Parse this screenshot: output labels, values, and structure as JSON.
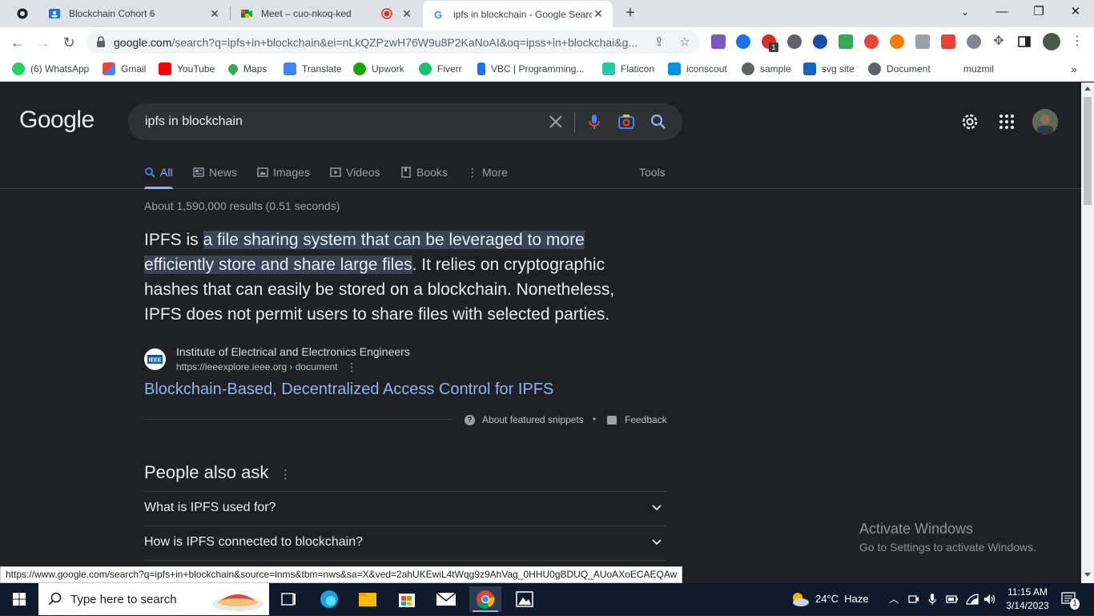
{
  "browser": {
    "tabs": [
      {
        "title": "Blockchain Cohort 6",
        "active": false
      },
      {
        "title": "Meet – cuo-nkoq-ked",
        "active": false
      },
      {
        "title": "ipfs in blockchain - Google Searc",
        "active": true
      }
    ],
    "url_host": "google.com",
    "url_rest": "/search?q=ipfs+in+blockchain&ei=nLkQZPzwH76W9u8P2KaNoAI&oq=ipss+in+blockchai&g...",
    "bookmarks": [
      "(6) WhatsApp",
      "Gmail",
      "YouTube",
      "Maps",
      "Translate",
      "Upwork",
      "Fiverr",
      "VBC | Programming...",
      "Flaticon",
      "iconscout",
      "sample",
      "svg site",
      "Document",
      "muzmil"
    ],
    "ext_badge": "1"
  },
  "google": {
    "logo": "Google",
    "query": "ipfs in blockchain",
    "tabs": [
      {
        "label": "All",
        "active": true
      },
      {
        "label": "News",
        "active": false
      },
      {
        "label": "Images",
        "active": false
      },
      {
        "label": "Videos",
        "active": false
      },
      {
        "label": "Books",
        "active": false
      },
      {
        "label": "More",
        "active": false
      }
    ],
    "tools": "Tools",
    "results_count": "About 1,590,000 results (0.51 seconds)",
    "snippet": {
      "pre": "IPFS is ",
      "highlight1": "a file sharing system that can be leveraged to more",
      "highlight2": "efficiently store and share large files",
      "post1": ". It relies on cryptographic",
      "line3": "hashes that can easily be stored on a blockchain. Nonetheless,",
      "line4": "IPFS does not permit users to share files with selected parties."
    },
    "source": {
      "name": "Institute of Electrical and Electronics Engineers",
      "url": "https://ieeexplore.ieee.org › document",
      "icon_text": "IEEE"
    },
    "result_title": "Blockchain-Based, Decentralized Access Control for IPFS",
    "about_snippets": "About featured snippets",
    "separator": "•",
    "feedback": "Feedback",
    "paa": {
      "title": "People also ask",
      "questions": [
        "What is IPFS used for?",
        "How is IPFS connected to blockchain?"
      ]
    }
  },
  "watermark": {
    "line1": "Activate Windows",
    "line2": "Go to Settings to activate Windows."
  },
  "status_url": "https://www.google.com/search?q=ipfs+in+blockchain&source=lnms&tbm=nws&sa=X&ved=2ahUKEwiL4tWqg9z9AhVag_0HHU0gBDUQ_AUoAXoECAEQAw",
  "taskbar": {
    "search_placeholder": "Type here to search",
    "weather": "24°C  Haze",
    "time": "11:15 AM",
    "date": "3/14/2023",
    "notif_count": "1"
  }
}
